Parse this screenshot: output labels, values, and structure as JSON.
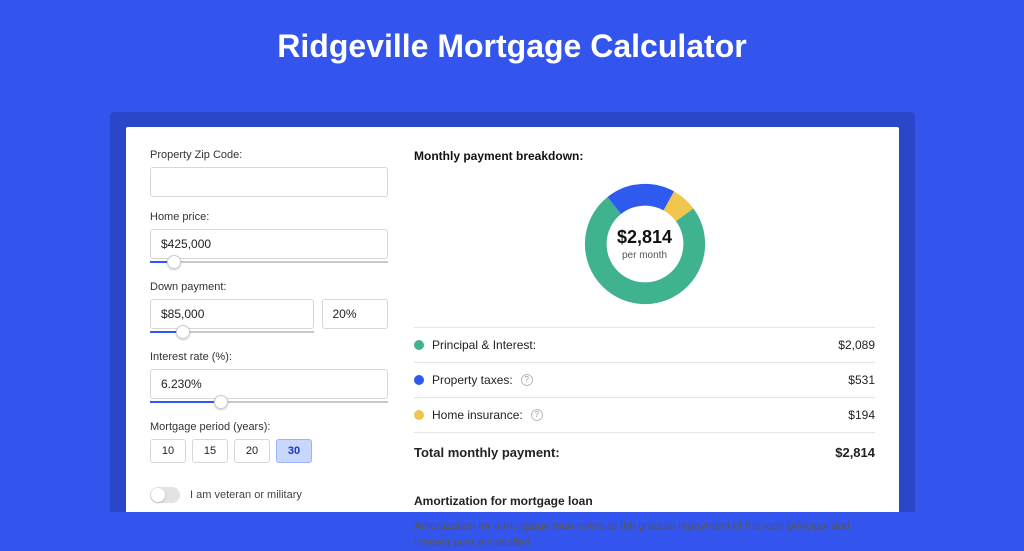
{
  "title": "Ridgeville Mortgage Calculator",
  "form": {
    "zip_label": "Property Zip Code:",
    "zip_value": "",
    "home_price_label": "Home price:",
    "home_price_value": "$425,000",
    "home_price_slider_pct": 10,
    "down_payment_label": "Down payment:",
    "down_payment_value": "$85,000",
    "down_payment_pct_value": "20%",
    "down_payment_slider_pct": 20,
    "interest_label": "Interest rate (%):",
    "interest_value": "6.230%",
    "interest_slider_pct": 30,
    "period_label": "Mortgage period (years):",
    "periods": [
      "10",
      "15",
      "20",
      "30"
    ],
    "period_selected": "30",
    "veteran_label": "I am veteran or military",
    "veteran_on": false
  },
  "breakdown": {
    "heading": "Monthly payment breakdown:",
    "center_amount": "$2,814",
    "center_sub": "per month",
    "items": [
      {
        "label": "Principal & Interest:",
        "value": "$2,089",
        "color": "#3fb28f",
        "num": 2089,
        "info": false
      },
      {
        "label": "Property taxes:",
        "value": "$531",
        "color": "#2f5af0",
        "num": 531,
        "info": true
      },
      {
        "label": "Home insurance:",
        "value": "$194",
        "color": "#f0c64f",
        "num": 194,
        "info": true
      }
    ],
    "total_label": "Total monthly payment:",
    "total_value": "$2,814",
    "total_num": 2814
  },
  "amortization": {
    "heading": "Amortization for mortgage loan",
    "text": "Amortization for a mortgage loan refers to the gradual repayment of the loan principal and interest over a specified"
  },
  "chart_data": {
    "type": "pie",
    "title": "Monthly payment breakdown",
    "series": [
      {
        "name": "Principal & Interest",
        "value": 2089,
        "color": "#3fb28f"
      },
      {
        "name": "Property taxes",
        "value": 531,
        "color": "#2f5af0"
      },
      {
        "name": "Home insurance",
        "value": 194,
        "color": "#f0c64f"
      }
    ],
    "total": 2814,
    "center_label": "$2,814 per month",
    "donut": true
  }
}
